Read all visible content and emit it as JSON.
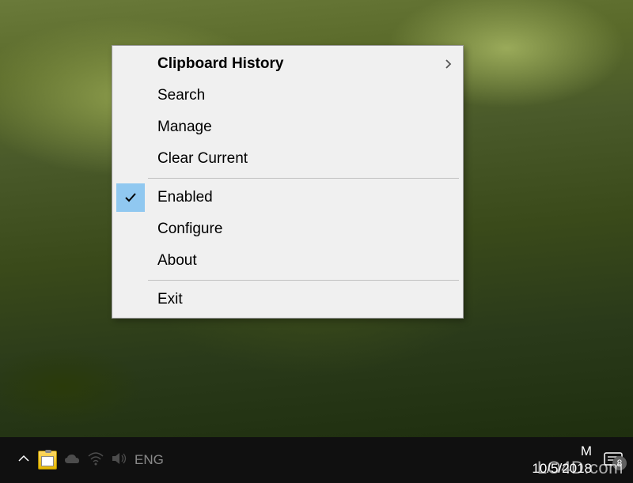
{
  "menu": {
    "items": [
      {
        "label": "Clipboard History",
        "bold": true,
        "submenu": true
      },
      {
        "label": "Search"
      },
      {
        "label": "Manage"
      },
      {
        "label": "Clear Current"
      }
    ],
    "items2": [
      {
        "label": "Enabled",
        "checked": true
      },
      {
        "label": "Configure"
      },
      {
        "label": "About"
      }
    ],
    "items3": [
      {
        "label": "Exit"
      }
    ]
  },
  "taskbar": {
    "language": "ENG",
    "time": "M",
    "date": "10/5/2018",
    "notification_count": "8"
  },
  "watermark": "LO4D.com"
}
